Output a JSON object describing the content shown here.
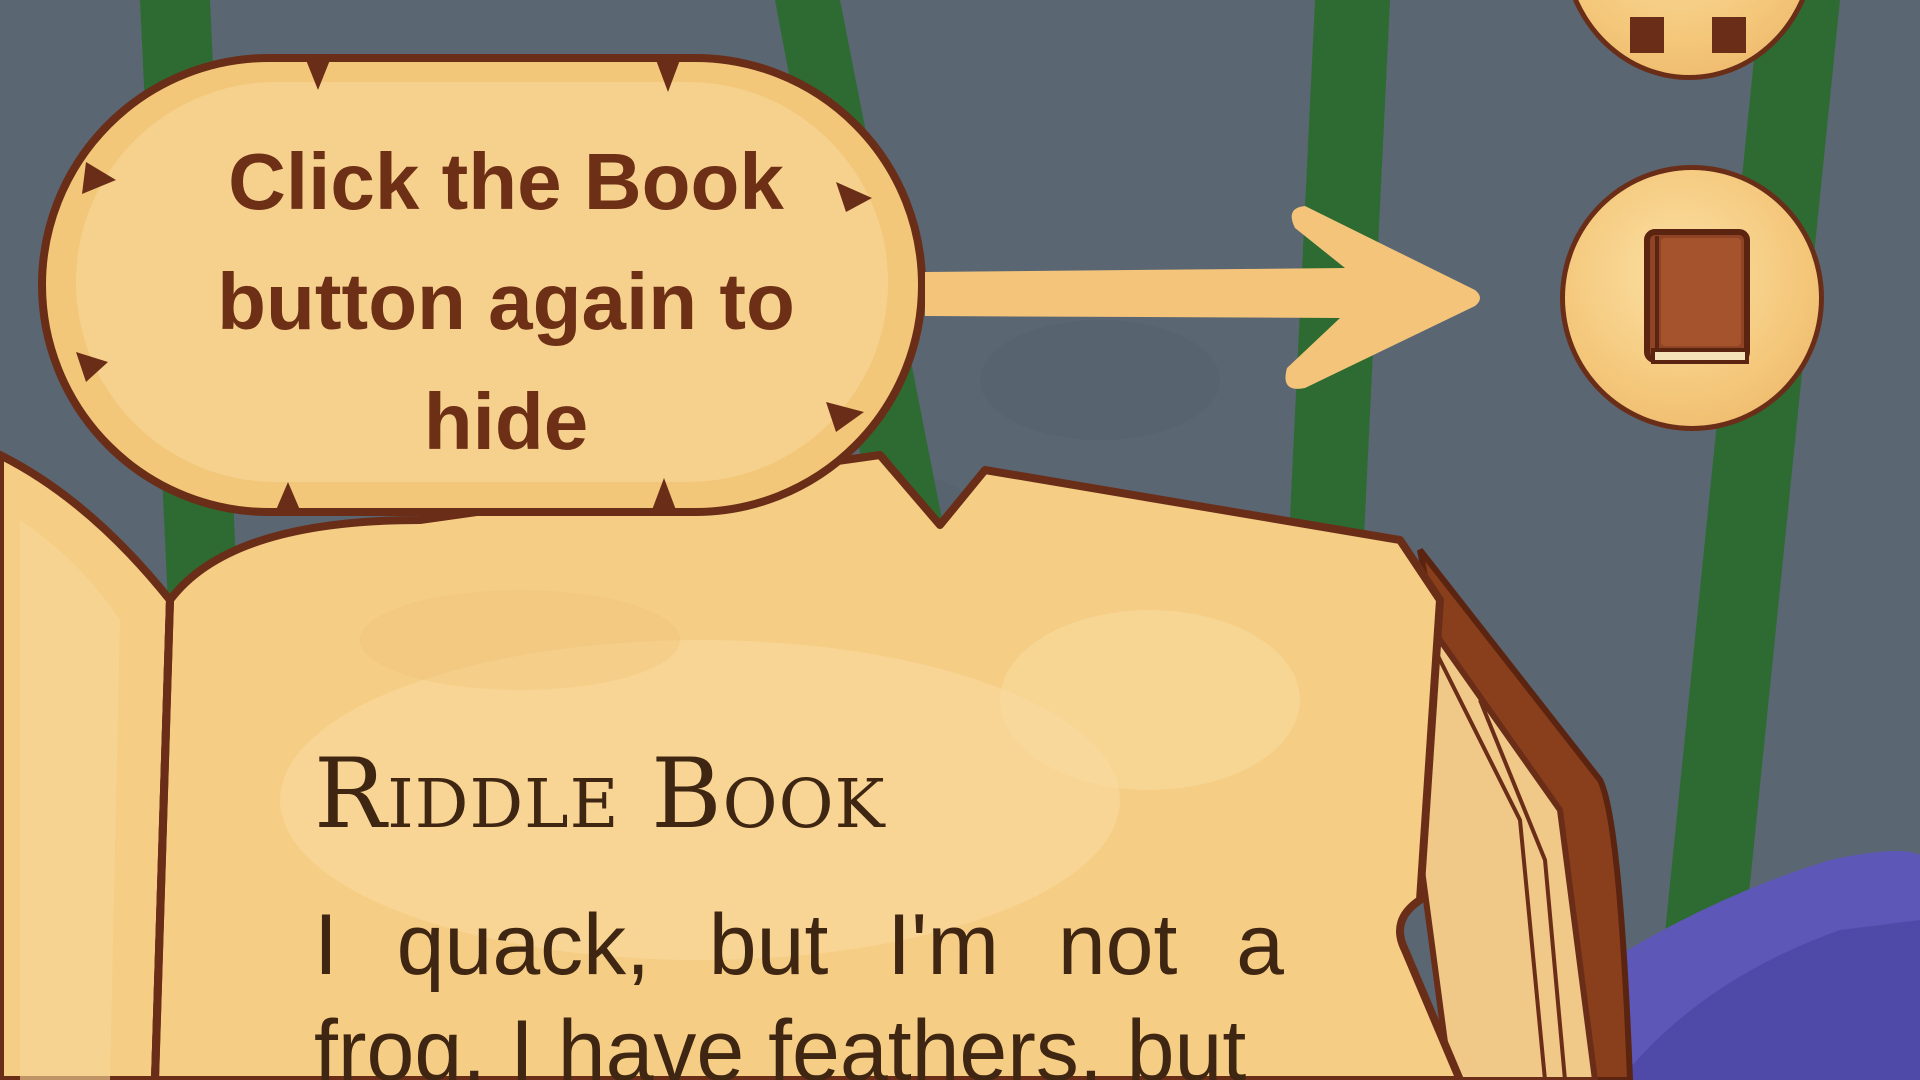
{
  "tooltip": {
    "lines": [
      "Click the Book",
      "button again to",
      "hide"
    ]
  },
  "book": {
    "title": "Riddle Book",
    "riddle_text": "I quack, but I'm not a frog. I have feathers, but"
  },
  "colors": {
    "background": "#5b6673",
    "vines": "#2e6b33",
    "parchment": "#f5cd85",
    "outline": "#6a2e18",
    "ink": "#3f2612",
    "arrow": "#f3c479"
  },
  "icons": {
    "hud_button_top": "pause-icon",
    "hud_button_book": "book-icon",
    "pointer": "arrow-right-icon"
  }
}
